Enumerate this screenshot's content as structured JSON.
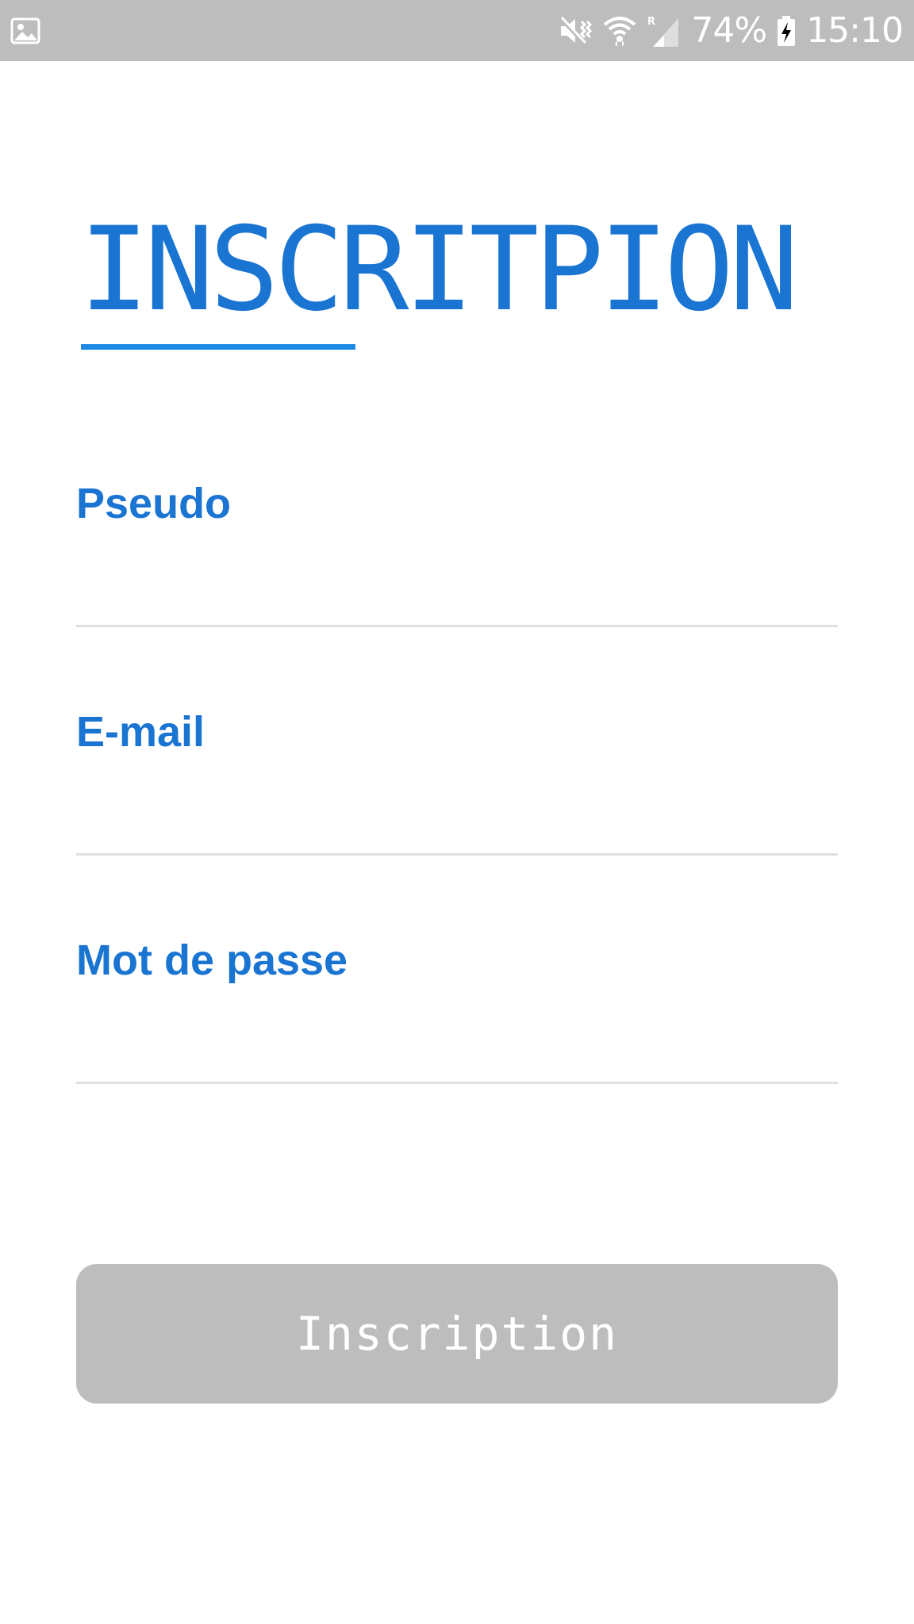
{
  "status_bar": {
    "battery": "74%",
    "time": "15:10",
    "icons": [
      "image-icon",
      "mute-vibrate-icon",
      "wifi-icon",
      "signal-roaming-icon",
      "battery-charging-icon"
    ]
  },
  "page": {
    "title": "INSCRITPION"
  },
  "form": {
    "pseudo": {
      "label": "Pseudo",
      "value": "",
      "placeholder": ""
    },
    "email": {
      "label": "E-mail",
      "value": "",
      "placeholder": ""
    },
    "password": {
      "label": "Mot de passe",
      "value": "",
      "placeholder": ""
    }
  },
  "submit": {
    "label": "Inscription"
  },
  "colors": {
    "accent": "#1a74d2",
    "underline": "#1e88e5",
    "status_bar": "#bdbdbd",
    "button_disabled": "#bdbdbd",
    "field_line": "#e0e0e0"
  }
}
